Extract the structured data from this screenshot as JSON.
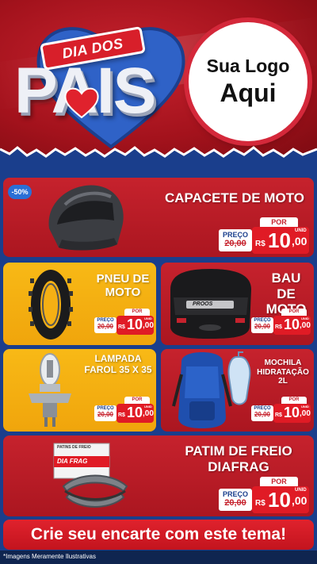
{
  "header": {
    "banner_text": "DIA DOS",
    "big_text": "PAIS",
    "logo_line1": "Sua Logo",
    "logo_line2": "Aqui"
  },
  "badge": "-50%",
  "products": [
    {
      "id": "capacete",
      "title": "CAPACETE DE MOTO",
      "por": "POR",
      "preco": "PREÇO",
      "old_price": "20,00",
      "old_prefix": "R$",
      "currency": "R$",
      "price_int": "10",
      "price_cents": ",00",
      "unit": "UNID",
      "image": "helmet-icon"
    },
    {
      "id": "pneu",
      "title": "PNEU DE MOTO",
      "por": "POR",
      "preco": "PREÇO",
      "old_price": "20,00",
      "old_prefix": "R$",
      "currency": "R$",
      "price_int": "10",
      "price_cents": ",00",
      "unit": "UNID",
      "image": "tire-icon"
    },
    {
      "id": "bau",
      "title": "BAU DE MOTO",
      "por": "POR",
      "preco": "PREÇO",
      "old_price": "20,00",
      "old_prefix": "R$",
      "currency": "R$",
      "price_int": "10",
      "price_cents": ",00",
      "unit": "UNID",
      "image": "top-case-icon",
      "brand": "PROOS"
    },
    {
      "id": "lampada",
      "title": "LAMPADA FAROL 35 X 35",
      "por": "POR",
      "preco": "PREÇO",
      "old_price": "20,00",
      "old_prefix": "R$",
      "currency": "R$",
      "price_int": "10",
      "price_cents": ",00",
      "unit": "UNID",
      "image": "bulb-icon"
    },
    {
      "id": "mochila",
      "title": "MOCHILA HIDRATAÇÃO 2L",
      "por": "POR",
      "preco": "PREÇO",
      "old_price": "20,00",
      "old_prefix": "R$",
      "currency": "R$",
      "price_int": "10",
      "price_cents": ",00",
      "unit": "UNID",
      "image": "backpack-icon"
    },
    {
      "id": "patim",
      "title": "PATIM DE FREIO DIAFRAG",
      "por": "POR",
      "preco": "PREÇO",
      "old_price": "20,00",
      "old_prefix": "R$",
      "currency": "R$",
      "price_int": "10",
      "price_cents": ",00",
      "unit": "UNID",
      "image": "brake-pad-icon",
      "box_text": "PATINS DE FREIO",
      "box_brand": "DIA FRAG"
    }
  ],
  "cta": "Crie seu encarte com este tema!",
  "footnote": "*Imagens Meramente Ilustrativas",
  "colors": {
    "red": "#c6222d",
    "yellow": "#f5b014",
    "blue": "#1a3e8c",
    "price_red": "#e01b25"
  }
}
